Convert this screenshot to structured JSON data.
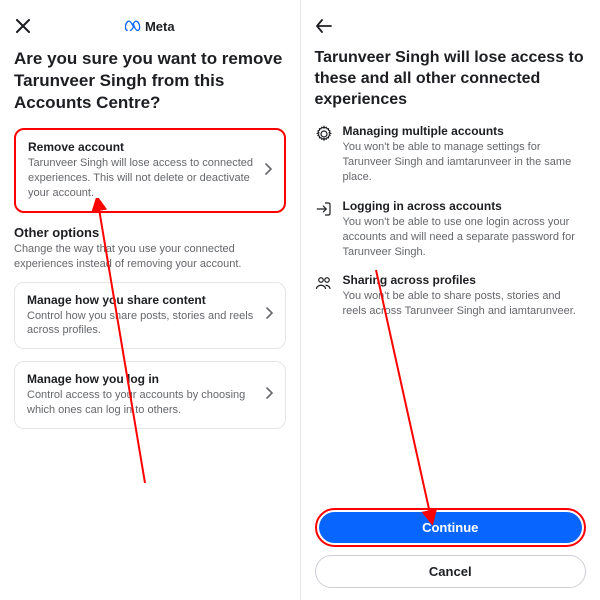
{
  "brand": "Meta",
  "left": {
    "title": "Are you sure you want to remove Tarunveer Singh from this Accounts Centre?",
    "remove": {
      "title": "Remove account",
      "desc": "Tarunveer Singh will lose access to connected experiences. This will not delete or deactivate your account."
    },
    "other_label": "Other options",
    "other_sub": "Change the way that you use your connected experiences instead of removing your account.",
    "share": {
      "title": "Manage how you share content",
      "desc": "Control how you share posts, stories and reels across profiles."
    },
    "login": {
      "title": "Manage how you log in",
      "desc": "Control access to your accounts by choosing which ones can log in to others."
    }
  },
  "right": {
    "title": "Tarunveer Singh will lose access to these and all other connected experiences",
    "items": [
      {
        "title": "Managing multiple accounts",
        "desc": "You won't be able to manage settings for Tarunveer Singh and iamtarunveer in the same place."
      },
      {
        "title": "Logging in across accounts",
        "desc": "You won't be able to use one login across your accounts and will need a separate password for Tarunveer Singh."
      },
      {
        "title": "Sharing across profiles",
        "desc": "You won't be able to share posts, stories and reels across Tarunveer Singh and iamtarunveer."
      }
    ],
    "continue": "Continue",
    "cancel": "Cancel"
  }
}
